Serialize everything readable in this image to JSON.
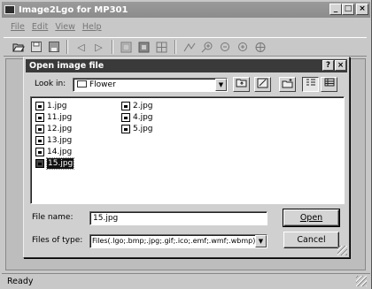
{
  "app": {
    "title": "Image2Lgo for MP301",
    "window_buttons": {
      "minimize": "_",
      "maximize": "□",
      "close": "×"
    }
  },
  "menu": {
    "items": [
      {
        "label": "File"
      },
      {
        "label": "Edit"
      },
      {
        "label": "View"
      },
      {
        "label": "Help"
      }
    ]
  },
  "toolbar": {
    "buttons": [
      "open-icon",
      "save-icon",
      "disk-icon",
      "prev-icon",
      "next-icon",
      "frame-icon",
      "stop-icon",
      "grid-icon",
      "bend-icon",
      "zoom-in-icon",
      "zoom-out-icon",
      "zoom-fit-icon"
    ]
  },
  "status": {
    "text": "Ready"
  },
  "dialog": {
    "title": "Open image file",
    "help_btn": "?",
    "close_btn": "×",
    "look_in_label": "Look in:",
    "look_in_value": "Flower",
    "files": [
      {
        "name": "1.jpg",
        "selected": false
      },
      {
        "name": "11.jpg",
        "selected": false
      },
      {
        "name": "12.jpg",
        "selected": false
      },
      {
        "name": "13.jpg",
        "selected": false
      },
      {
        "name": "14.jpg",
        "selected": false
      },
      {
        "name": "15.jpg",
        "selected": true
      },
      {
        "name": "2.jpg",
        "selected": false
      },
      {
        "name": "4.jpg",
        "selected": false
      },
      {
        "name": "5.jpg",
        "selected": false
      }
    ],
    "file_name_label": "File name:",
    "file_name_value": "15.jpg",
    "file_type_label": "Files of type:",
    "file_type_value": "Files(.lgo;.bmp;.jpg;.gif;.ico;.emf;.wmf;.wbmp)",
    "open_button": "Open",
    "cancel_button": "Cancel"
  }
}
